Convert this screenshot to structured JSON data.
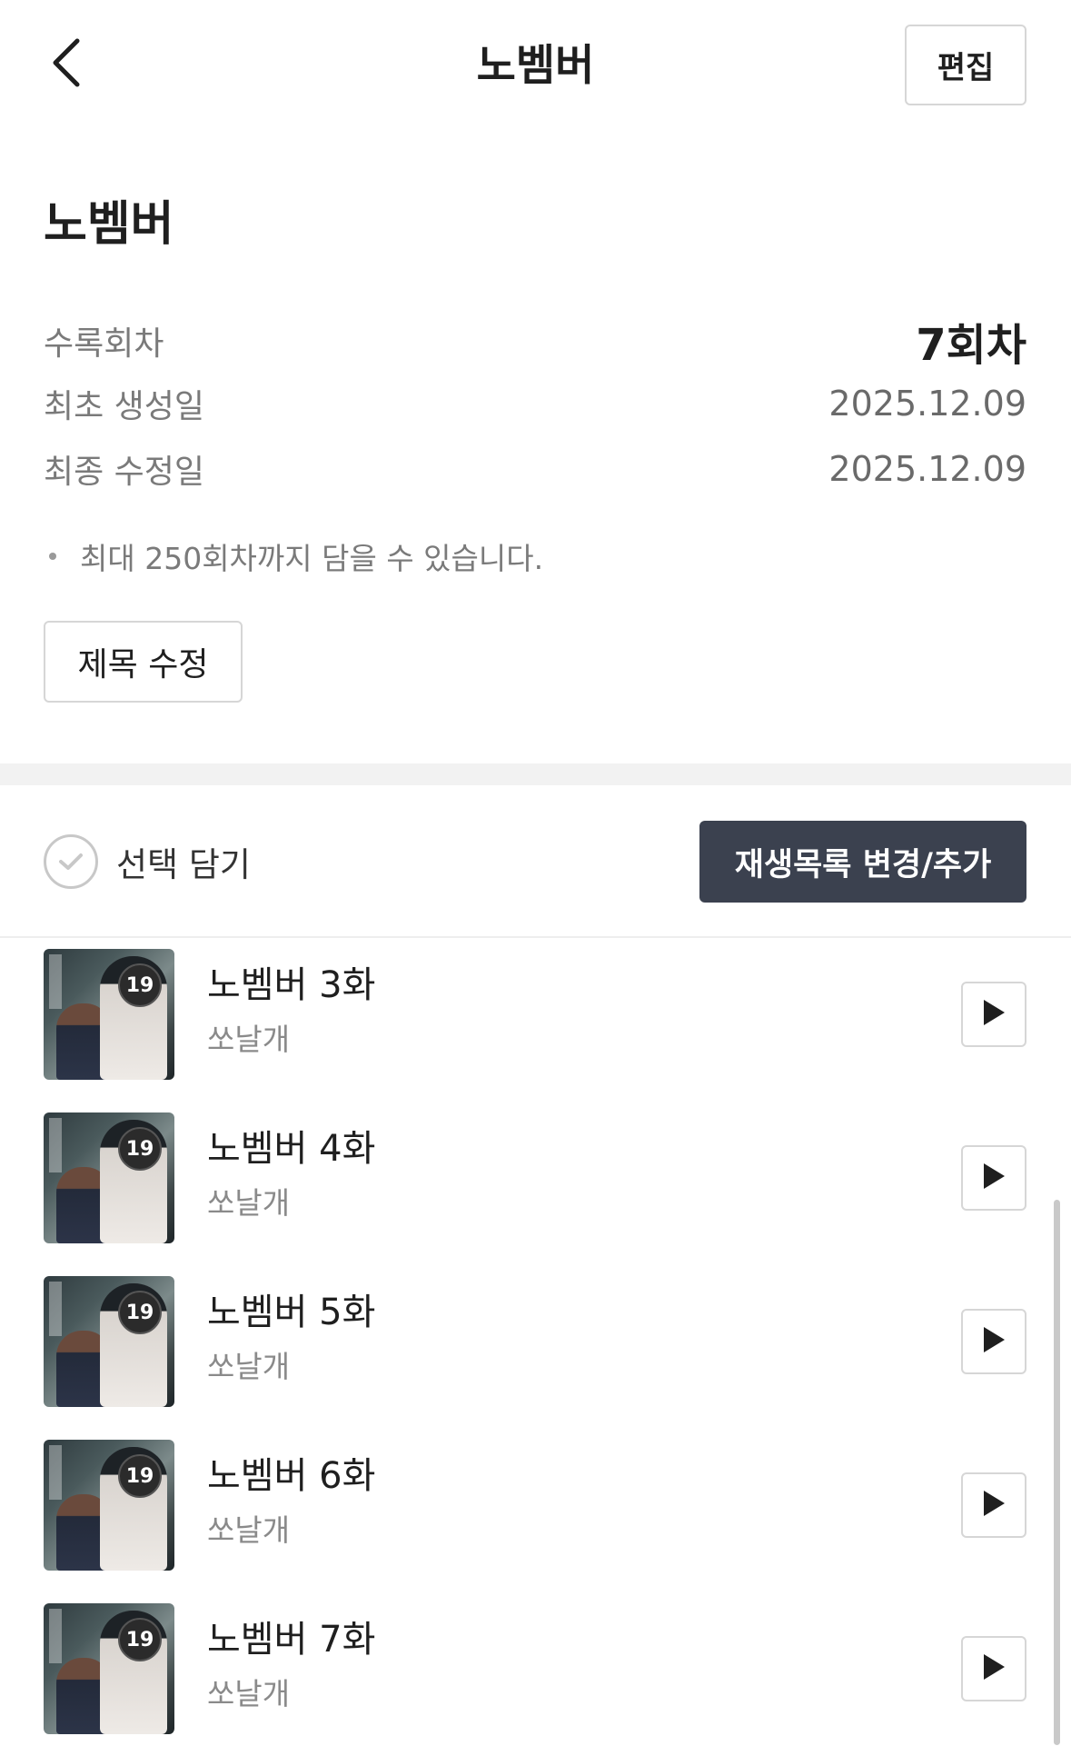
{
  "header": {
    "title": "노벰버",
    "edit_label": "편집",
    "back_icon": "chevron-left-icon"
  },
  "info": {
    "name": "노벰버",
    "rows": [
      {
        "label": "수록회차",
        "value": "7회차"
      },
      {
        "label": "최초 생성일",
        "value": "2025.12.09"
      },
      {
        "label": "최종 수정일",
        "value": "2025.12.09"
      }
    ],
    "note": "최대 250회차까지 담을 수 있습니다.",
    "title_edit_label": "제목 수정"
  },
  "toolbar": {
    "select_label": "선택 담기",
    "playlist_button_label": "재생목록 변경/추가"
  },
  "episodes": [
    {
      "title": "노벰버 3화",
      "author": "쏘날개",
      "age_badge": "19"
    },
    {
      "title": "노벰버 4화",
      "author": "쏘날개",
      "age_badge": "19"
    },
    {
      "title": "노벰버 5화",
      "author": "쏘날개",
      "age_badge": "19"
    },
    {
      "title": "노벰버 6화",
      "author": "쏘날개",
      "age_badge": "19"
    },
    {
      "title": "노벰버 7화",
      "author": "쏘날개",
      "age_badge": "19"
    }
  ],
  "colors": {
    "primary_button": "#3b414f",
    "text_primary": "#1f1f1f",
    "text_secondary": "#7a7a7a",
    "border": "#d6d6d6"
  }
}
